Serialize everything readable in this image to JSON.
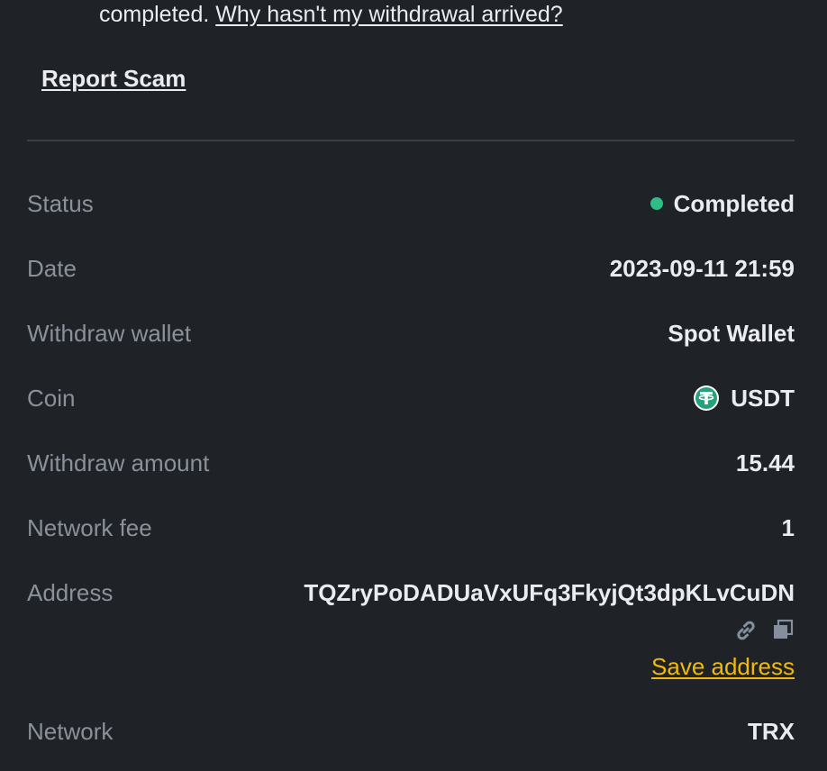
{
  "notice": {
    "text_prefix": "completed.",
    "link": "Why hasn't my withdrawal arrived?"
  },
  "report_scam": "Report Scam",
  "details": {
    "status": {
      "label": "Status",
      "value": "Completed",
      "color": "#2ebd85"
    },
    "date": {
      "label": "Date",
      "value": "2023-09-11 21:59"
    },
    "wallet": {
      "label": "Withdraw wallet",
      "value": "Spot Wallet"
    },
    "coin": {
      "label": "Coin",
      "value": "USDT",
      "icon": "tether-icon"
    },
    "amount": {
      "label": "Withdraw amount",
      "value": "15.44"
    },
    "fee": {
      "label": "Network fee",
      "value": "1"
    },
    "address": {
      "label": "Address",
      "value": "TQZryPoDADUaVxUFq3FkyjQt3dpKLvCuDN",
      "save_label": "Save address"
    },
    "network": {
      "label": "Network",
      "value": "TRX"
    }
  },
  "colors": {
    "background": "#1f2227",
    "label": "#8b919a",
    "value": "#eaecef",
    "accent": "#f0b90b",
    "success": "#2ebd85"
  }
}
